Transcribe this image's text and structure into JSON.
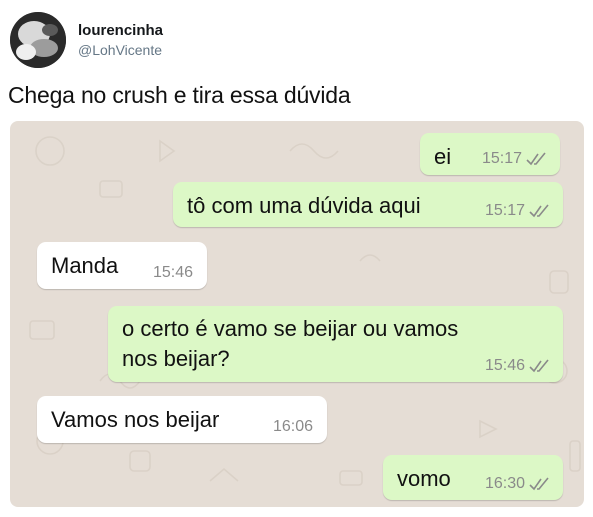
{
  "tweet": {
    "display_name": "lourencinha",
    "handle": "@LohVicente",
    "text": "Chega no crush e tira essa dúvida"
  },
  "chat": {
    "background_color": "#e5ddd5",
    "outgoing_color": "#dcf8c6",
    "incoming_color": "#ffffff",
    "messages": [
      {
        "direction": "out",
        "text": "ei",
        "time": "15:17",
        "status_icon": "double-check-icon"
      },
      {
        "direction": "out",
        "text": "tô com uma dúvida aqui",
        "time": "15:17",
        "status_icon": "double-check-icon"
      },
      {
        "direction": "in",
        "text": "Manda",
        "time": "15:46"
      },
      {
        "direction": "out",
        "text_line1": "o certo é vamo se beijar ou vamos",
        "text_line2": "nos beijar?",
        "time": "15:46",
        "status_icon": "double-check-icon"
      },
      {
        "direction": "in",
        "text": "Vamos nos beijar",
        "time": "16:06"
      },
      {
        "direction": "out",
        "text": "vomo",
        "time": "16:30",
        "status_icon": "double-check-icon"
      }
    ]
  }
}
